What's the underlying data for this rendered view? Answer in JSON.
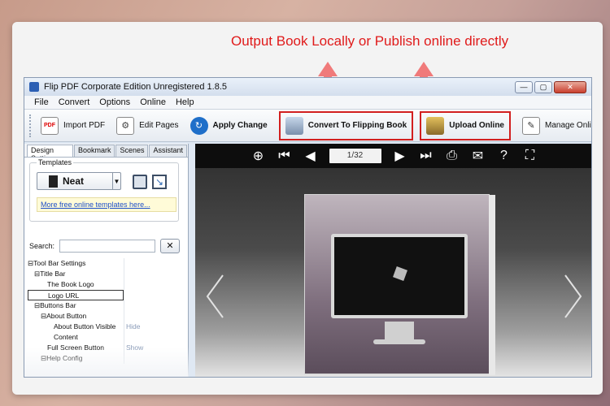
{
  "annotation": {
    "text": "Output Book Locally or Publish online directly"
  },
  "colors": {
    "annotation": "#e01a1a",
    "highlight_box": "#d21f1f",
    "viewer_bar": "#0d0d0d"
  },
  "window": {
    "title": "Flip PDF Corporate Edition Unregistered 1.8.5"
  },
  "menu": [
    "File",
    "Convert",
    "Options",
    "Online",
    "Help"
  ],
  "toolbar": {
    "import_pdf": "Import PDF",
    "edit_pages": "Edit Pages",
    "apply_change": "Apply Change",
    "convert": "Convert To Flipping Book",
    "upload": "Upload Online",
    "manage": "Manage Online Books"
  },
  "tabs": [
    "Design Setting",
    "Bookmark",
    "Scenes",
    "Assistant"
  ],
  "templates": {
    "label": "Templates",
    "selected": "Neat",
    "link": "More free online templates here..."
  },
  "search": {
    "label": "Search:",
    "clear": "✕"
  },
  "tree": [
    {
      "label": "⊟Tool Bar Settings",
      "value": "",
      "indent": 0
    },
    {
      "label": "⊟Title Bar",
      "value": "",
      "indent": 1
    },
    {
      "label": "The Book Logo",
      "value": "",
      "indent": 3
    },
    {
      "label": "Logo URL",
      "value": "",
      "indent": 3
    },
    {
      "label": "⊟Buttons Bar",
      "value": "",
      "indent": 1
    },
    {
      "label": "⊟About Button",
      "value": "",
      "indent": 2
    },
    {
      "label": "About Button Visible",
      "value": "Hide",
      "indent": 4
    },
    {
      "label": "Content",
      "value": "",
      "indent": 4
    },
    {
      "label": "Full Screen Button",
      "value": "Show",
      "indent": 3
    },
    {
      "label": "⊟Help Config",
      "value": "",
      "indent": 2
    }
  ],
  "viewer": {
    "page_indicator": "1/32"
  },
  "icons": {
    "zoom": "zoom-in-icon",
    "first": "first-page-icon",
    "prev": "previous-page-icon",
    "next": "next-page-icon",
    "last": "last-page-icon",
    "print": "print-icon",
    "email": "email-icon",
    "help": "help-icon",
    "fullscreen": "fullscreen-icon"
  }
}
